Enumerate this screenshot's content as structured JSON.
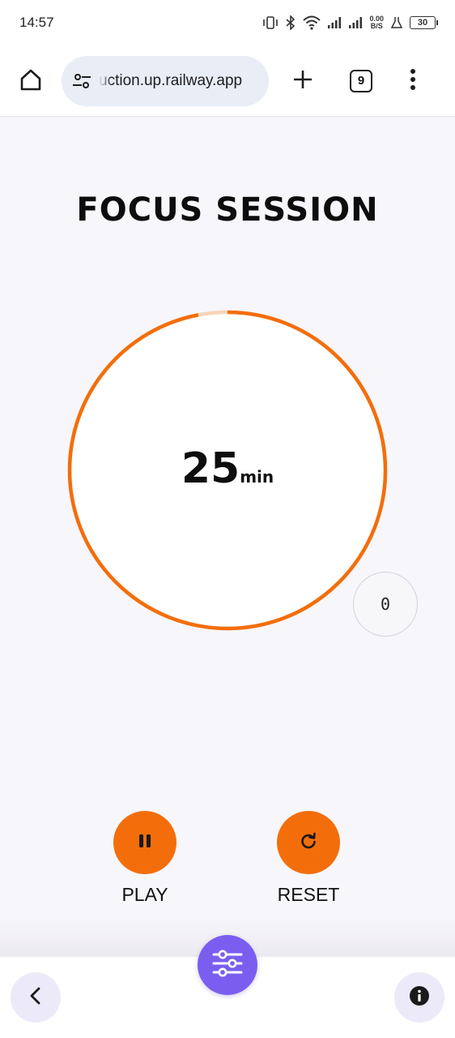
{
  "status_bar": {
    "time": "14:57",
    "net_speed_value": "0.00",
    "net_speed_unit": "B/S",
    "battery": "30"
  },
  "browser": {
    "url": "uction.up.railway.app",
    "tab_count": "9",
    "icons": {
      "home": "home-icon",
      "site_settings": "site-settings-icon",
      "new_tab": "plus-icon",
      "menu": "more-vert-icon"
    }
  },
  "page": {
    "title": "FOCUS SESSION",
    "timer": {
      "value": "25",
      "unit": "min",
      "progress_fraction": 0.97
    },
    "session_count": "0",
    "controls": {
      "play_label": "PLAY",
      "reset_label": "RESET"
    }
  },
  "bottom_nav": {
    "icons": {
      "back": "chevron-left-icon",
      "settings": "sliders-icon",
      "info": "info-icon"
    }
  },
  "colors": {
    "accent_orange": "#f36e0b",
    "ring_track": "#f8d5b8",
    "fab_purple": "#7a5ef0",
    "nav_button_bg": "#ece9f8",
    "page_bg": "#f7f6fb"
  }
}
